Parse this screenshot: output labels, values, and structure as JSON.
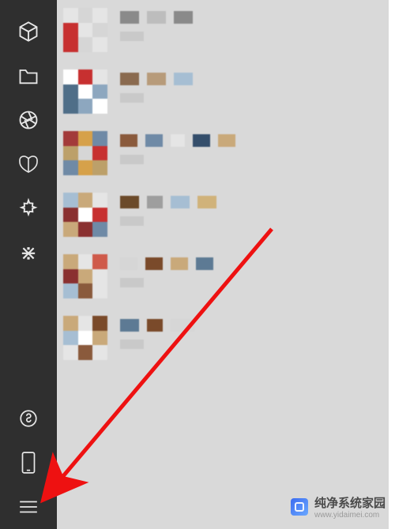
{
  "sidebar": {
    "items": [
      {
        "name": "cube-icon"
      },
      {
        "name": "folder-icon"
      },
      {
        "name": "aperture-icon"
      },
      {
        "name": "butterfly-icon"
      },
      {
        "name": "star-icon"
      },
      {
        "name": "spark-icon"
      },
      {
        "name": "mini-program-icon"
      },
      {
        "name": "mobile-icon"
      },
      {
        "name": "hamburger-icon"
      }
    ]
  },
  "annotation": {
    "type": "arrow",
    "color": "#e11",
    "points_to": "hamburger-icon"
  },
  "list": [
    {
      "thumb": [
        "#e5e5e5",
        "#d6d6d6",
        "#e5e5e5",
        "#c73030",
        "#e5e5e5",
        "#d6d6d6",
        "#c73030",
        "#d6d6d6",
        "#e5e5e5"
      ],
      "line1": [
        [
          "#8a8a8a",
          24
        ],
        [
          "#bdbdbd",
          24
        ],
        [
          "#8a8a8a",
          24
        ]
      ],
      "line2": [
        [
          "#c9c9c9",
          30
        ]
      ]
    },
    {
      "thumb": [
        "#fff",
        "#c73030",
        "#e5e5e5",
        "#4f6e88",
        "#fff",
        "#8da7bf",
        "#4f6e88",
        "#8da7bf",
        "#fff"
      ],
      "line1": [
        [
          "#8a6a4f",
          24
        ],
        [
          "#b79b7a",
          24
        ],
        [
          "#a6bed3",
          24
        ]
      ],
      "line2": [
        [
          "#c9c9c9",
          30
        ]
      ]
    },
    {
      "thumb": [
        "#a33a3a",
        "#d6a14a",
        "#6f8aa6",
        "#bca06a",
        "#d6d6d6",
        "#c73030",
        "#6f8aa6",
        "#d6a14a",
        "#bca06a"
      ],
      "line1": [
        [
          "#8a5a3c",
          22
        ],
        [
          "#6f8aa6",
          22
        ],
        [
          "#e5e5e5",
          18
        ],
        [
          "#344e6b",
          22
        ],
        [
          "#c9a97a",
          22
        ]
      ],
      "line2": [
        [
          "#c9c9c9",
          30
        ]
      ]
    },
    {
      "thumb": [
        "#a6bed3",
        "#c9a97a",
        "#e5e5e5",
        "#8a3030",
        "#fff",
        "#c73030",
        "#c9a97a",
        "#8a3030",
        "#6f8aa6"
      ],
      "line1": [
        [
          "#6b4a2a",
          24
        ],
        [
          "#9e9e9e",
          20
        ],
        [
          "#a6bed3",
          24
        ],
        [
          "#d0b27a",
          24
        ]
      ],
      "line2": [
        [
          "#c9c9c9",
          30
        ]
      ]
    },
    {
      "thumb": [
        "#c9a97a",
        "#e5e5e5",
        "#cf5a4a",
        "#8a3030",
        "#c9a97a",
        "#e5e5e5",
        "#a6bed3",
        "#8a5a3c",
        "#e5e5e5"
      ],
      "line1": [
        [
          "#d6d6d6",
          22
        ],
        [
          "#7a4a2a",
          22
        ],
        [
          "#c9a97a",
          22
        ],
        [
          "#5d7a94",
          22
        ]
      ],
      "line2": [
        [
          "#c9c9c9",
          30
        ]
      ]
    },
    {
      "thumb": [
        "#c9a97a",
        "#e5e5e5",
        "#7a4a2a",
        "#a6bed3",
        "#fff",
        "#c9a97a",
        "#e5e5e5",
        "#8a5a3c",
        "#e5e5e5"
      ],
      "line1": [
        [
          "#5d7a94",
          24
        ],
        [
          "#7a4a2a",
          20
        ],
        [
          "#d6d6d6",
          30
        ]
      ],
      "line2": [
        [
          "#c9c9c9",
          30
        ]
      ]
    }
  ],
  "watermark": {
    "title": "纯净系统家园",
    "url": "www.yidaimei.com"
  }
}
